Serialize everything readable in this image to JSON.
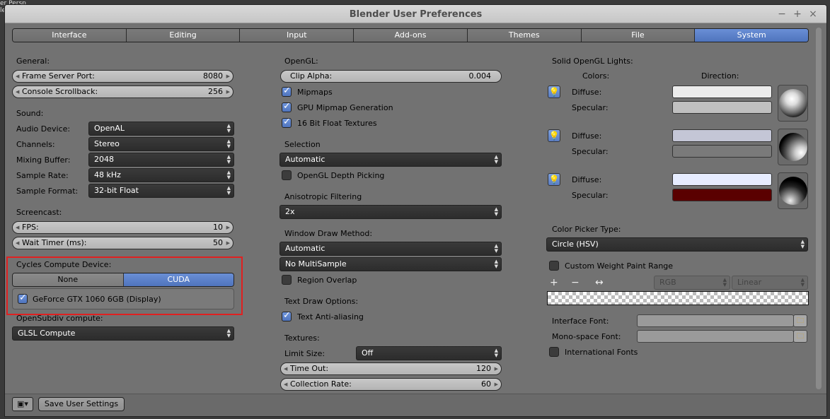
{
  "bg_text": "er Persp\nle",
  "window": {
    "title": "Blender User Preferences"
  },
  "tabs": [
    {
      "label": "Interface"
    },
    {
      "label": "Editing"
    },
    {
      "label": "Input"
    },
    {
      "label": "Add-ons"
    },
    {
      "label": "Themes"
    },
    {
      "label": "File"
    },
    {
      "label": "System",
      "active": true
    }
  ],
  "general": {
    "heading": "General:",
    "frame_server_port": {
      "label": "Frame Server Port:",
      "value": "8080"
    },
    "console_scrollback": {
      "label": "Console Scrollback:",
      "value": "256"
    }
  },
  "sound": {
    "heading": "Sound:",
    "audio_device": {
      "label": "Audio Device:",
      "value": "OpenAL"
    },
    "channels": {
      "label": "Channels:",
      "value": "Stereo"
    },
    "mixing_buffer": {
      "label": "Mixing Buffer:",
      "value": "2048"
    },
    "sample_rate": {
      "label": "Sample Rate:",
      "value": "48 kHz"
    },
    "sample_format": {
      "label": "Sample Format:",
      "value": "32-bit Float"
    }
  },
  "screencast": {
    "heading": "Screencast:",
    "fps": {
      "label": "FPS:",
      "value": "10"
    },
    "wait_timer": {
      "label": "Wait Timer (ms):",
      "value": "50"
    }
  },
  "cycles": {
    "heading": "Cycles Compute Device:",
    "options": [
      {
        "label": "None"
      },
      {
        "label": "CUDA",
        "active": true
      }
    ],
    "device": {
      "label": "GeForce GTX 1060 6GB (Display)",
      "checked": true
    }
  },
  "opensubdiv": {
    "heading": "OpenSubdiv compute:",
    "value": "GLSL Compute"
  },
  "opengl": {
    "heading": "OpenGL:",
    "clip_alpha": {
      "label": "Clip Alpha:",
      "value": "0.004"
    },
    "mipmaps": {
      "label": "Mipmaps",
      "checked": true
    },
    "gpu_mipmap": {
      "label": "GPU Mipmap Generation",
      "checked": true
    },
    "float_textures": {
      "label": "16 Bit Float Textures",
      "checked": true
    }
  },
  "selection": {
    "heading": "Selection",
    "value": "Automatic",
    "depth_picking": {
      "label": "OpenGL Depth Picking",
      "checked": false
    }
  },
  "anisotropic": {
    "heading": "Anisotropic Filtering",
    "value": "2x"
  },
  "window_draw": {
    "heading": "Window Draw Method:",
    "value": "Automatic",
    "multisample": "No MultiSample",
    "region_overlap": {
      "label": "Region Overlap",
      "checked": false
    }
  },
  "text_draw": {
    "heading": "Text Draw Options:",
    "anti_aliasing": {
      "label": "Text Anti-aliasing",
      "checked": true
    }
  },
  "textures": {
    "heading": "Textures:",
    "limit_size": {
      "label": "Limit Size:",
      "value": "Off"
    },
    "time_out": {
      "label": "Time Out:",
      "value": "120"
    },
    "collection_rate": {
      "label": "Collection Rate:",
      "value": "60"
    }
  },
  "lights": {
    "heading": "Solid OpenGL Lights:",
    "colors_label": "Colors:",
    "direction_label": "Direction:",
    "diffuse_label": "Diffuse:",
    "specular_label": "Specular:",
    "items": [
      {
        "diffuse_color": "#ebebeb",
        "specular_color": "#c0c0c0"
      },
      {
        "diffuse_color": "#c4c6d6",
        "specular_color": "#7a7a7a"
      },
      {
        "diffuse_color": "#e6ecff",
        "specular_color": "#5a0000"
      }
    ]
  },
  "color_picker": {
    "heading": "Color Picker Type:",
    "value": "Circle (HSV)"
  },
  "weight_paint": {
    "custom_range": {
      "label": "Custom Weight Paint Range",
      "checked": false
    },
    "color_mode": "RGB",
    "interpolation": "Linear"
  },
  "fonts": {
    "interface_font": {
      "label": "Interface Font:",
      "value": ""
    },
    "mono_font": {
      "label": "Mono-space Font:",
      "value": ""
    },
    "international": {
      "label": "International Fonts",
      "checked": false
    }
  },
  "footer": {
    "save_label": "Save User Settings"
  },
  "colors": {
    "accent": "#5a7fc8",
    "highlight_box": "#e02020"
  }
}
